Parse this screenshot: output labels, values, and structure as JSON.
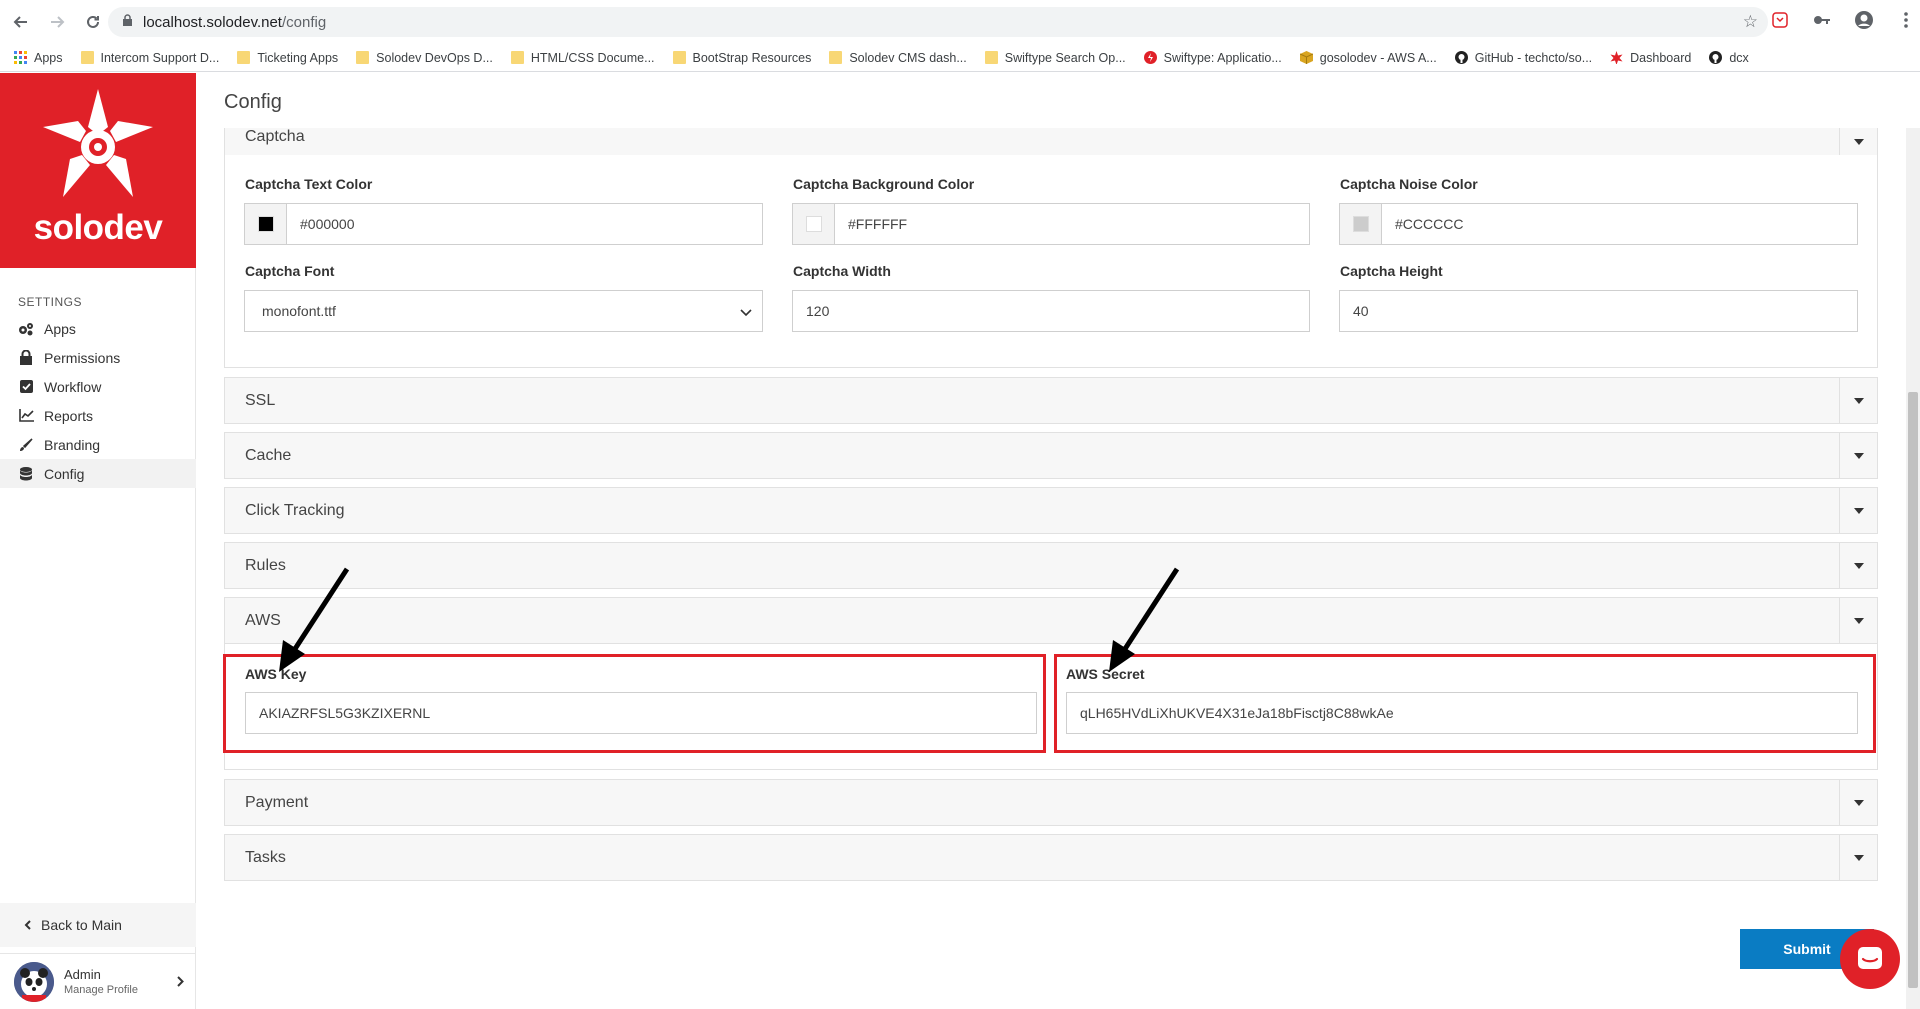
{
  "browser": {
    "url_host": "localhost.solodev.net",
    "url_path": "/config",
    "bookmarks": [
      {
        "label": "Apps",
        "icon": "apps-grid-icon"
      },
      {
        "label": "Intercom Support D...",
        "icon": "folder-icon"
      },
      {
        "label": "Ticketing Apps",
        "icon": "folder-icon"
      },
      {
        "label": "Solodev DevOps D...",
        "icon": "folder-icon"
      },
      {
        "label": "HTML/CSS Docume...",
        "icon": "folder-icon"
      },
      {
        "label": "BootStrap Resources",
        "icon": "folder-icon"
      },
      {
        "label": "Solodev CMS dash...",
        "icon": "folder-icon"
      },
      {
        "label": "Swiftype Search Op...",
        "icon": "folder-icon"
      },
      {
        "label": "Swiftype: Applicatio...",
        "icon": "swiftype-icon"
      },
      {
        "label": "gosolodev - AWS A...",
        "icon": "aws-box-icon"
      },
      {
        "label": "GitHub - techcto/so...",
        "icon": "github-icon"
      },
      {
        "label": "Dashboard",
        "icon": "solodev-icon"
      },
      {
        "label": "dcx",
        "icon": "github-icon"
      }
    ]
  },
  "sidebar": {
    "brand": "solodev",
    "section_header": "SETTINGS",
    "items": [
      {
        "label": "Apps",
        "icon": "gears-icon"
      },
      {
        "label": "Permissions",
        "icon": "lock-icon"
      },
      {
        "label": "Workflow",
        "icon": "checkbox-icon"
      },
      {
        "label": "Reports",
        "icon": "line-chart-icon"
      },
      {
        "label": "Branding",
        "icon": "paintbrush-icon"
      },
      {
        "label": "Config",
        "icon": "database-icon"
      }
    ],
    "active_item": "Config",
    "back_label": "Back to Main",
    "profile_name": "Admin",
    "profile_sub": "Manage Profile"
  },
  "page": {
    "title": "Config",
    "captcha": {
      "header": "Captcha",
      "text_color_label": "Captcha Text Color",
      "text_color_value": "#000000",
      "bg_color_label": "Captcha Background Color",
      "bg_color_value": "#FFFFFF",
      "noise_color_label": "Captcha Noise Color",
      "noise_color_value": "#CCCCCC",
      "font_label": "Captcha Font",
      "font_value": "monofont.ttf",
      "width_label": "Captcha Width",
      "width_value": "120",
      "height_label": "Captcha Height",
      "height_value": "40"
    },
    "sections": [
      "SSL",
      "Cache",
      "Click Tracking",
      "Rules"
    ],
    "aws": {
      "header": "AWS",
      "key_label": "AWS Key",
      "key_value": "AKIAZRFSL5G3KZIXERNL",
      "secret_label": "AWS Secret",
      "secret_value": "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"
    },
    "sections_after": [
      "Payment",
      "Tasks"
    ],
    "submit_label": "Submit"
  },
  "colors": {
    "brand_red": "#e02128",
    "submit_blue": "#0a7cc3",
    "highlight_red": "#e02128"
  }
}
